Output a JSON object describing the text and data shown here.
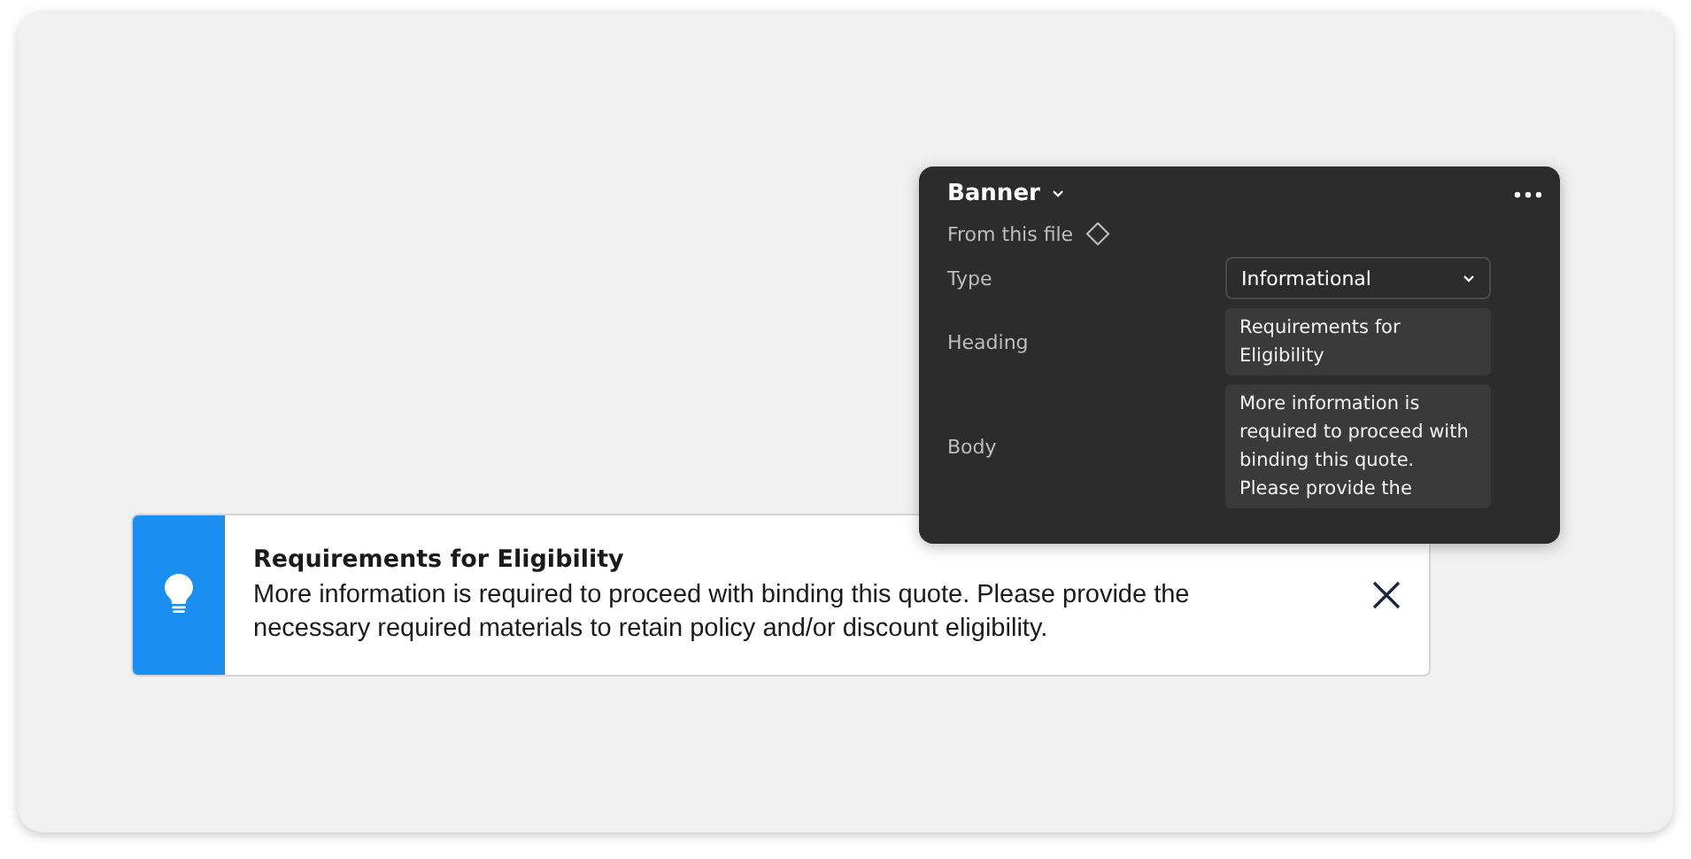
{
  "banner": {
    "kind": "info",
    "heading": "Requirements for Eligibility",
    "body": "More information is required to proceed with binding this quote. Please provide the necessary required materials to retain policy and/or discount eligibility."
  },
  "panel": {
    "title": "Banner",
    "source": "From this file",
    "fields": [
      {
        "kind": "select",
        "label": "Type",
        "value": "Informational"
      },
      {
        "kind": "text",
        "label": "Heading",
        "value": "Requirements for Eligibility"
      },
      {
        "kind": "text",
        "label": "Body",
        "value": "More information is required to proceed with binding this quote. Please provide the"
      }
    ]
  }
}
